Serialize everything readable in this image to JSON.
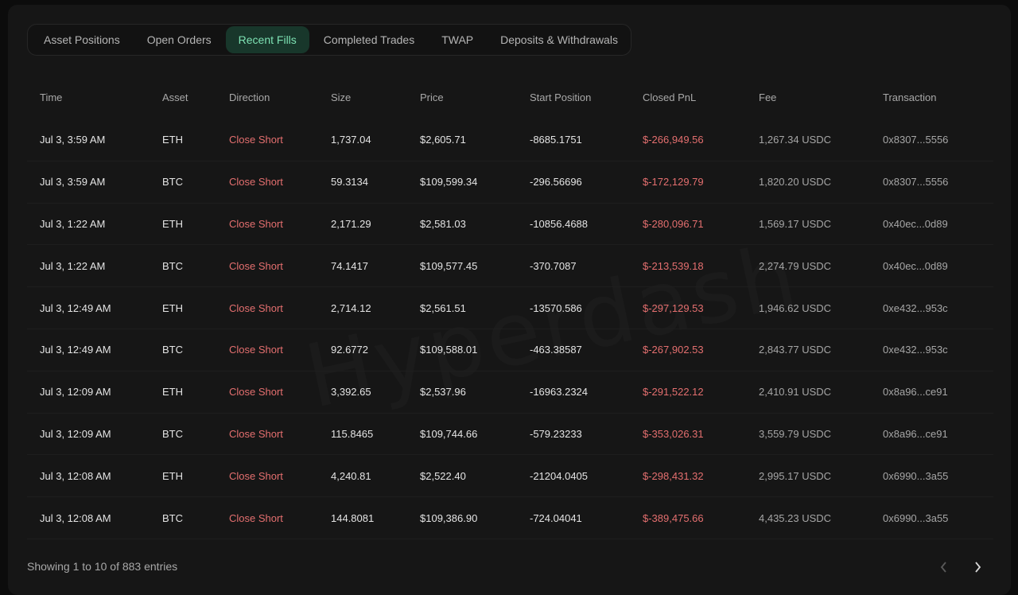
{
  "tabs": [
    {
      "label": "Asset Positions",
      "active": false
    },
    {
      "label": "Open Orders",
      "active": false
    },
    {
      "label": "Recent Fills",
      "active": true
    },
    {
      "label": "Completed Trades",
      "active": false
    },
    {
      "label": "TWAP",
      "active": false
    },
    {
      "label": "Deposits & Withdrawals",
      "active": false
    }
  ],
  "table": {
    "columns": [
      "Time",
      "Asset",
      "Direction",
      "Size",
      "Price",
      "Start Position",
      "Closed PnL",
      "Fee",
      "Transaction"
    ],
    "rows": [
      [
        "Jul 3, 3:59 AM",
        "ETH",
        "Close Short",
        "1,737.04",
        "$2,605.71",
        "-8685.1751",
        "$-266,949.56",
        "1,267.34 USDC",
        "0x8307...5556"
      ],
      [
        "Jul 3, 3:59 AM",
        "BTC",
        "Close Short",
        "59.3134",
        "$109,599.34",
        "-296.56696",
        "$-172,129.79",
        "1,820.20 USDC",
        "0x8307...5556"
      ],
      [
        "Jul 3, 1:22 AM",
        "ETH",
        "Close Short",
        "2,171.29",
        "$2,581.03",
        "-10856.4688",
        "$-280,096.71",
        "1,569.17 USDC",
        "0x40ec...0d89"
      ],
      [
        "Jul 3, 1:22 AM",
        "BTC",
        "Close Short",
        "74.1417",
        "$109,577.45",
        "-370.7087",
        "$-213,539.18",
        "2,274.79 USDC",
        "0x40ec...0d89"
      ],
      [
        "Jul 3, 12:49 AM",
        "ETH",
        "Close Short",
        "2,714.12",
        "$2,561.51",
        "-13570.586",
        "$-297,129.53",
        "1,946.62 USDC",
        "0xe432...953c"
      ],
      [
        "Jul 3, 12:49 AM",
        "BTC",
        "Close Short",
        "92.6772",
        "$109,588.01",
        "-463.38587",
        "$-267,902.53",
        "2,843.77 USDC",
        "0xe432...953c"
      ],
      [
        "Jul 3, 12:09 AM",
        "ETH",
        "Close Short",
        "3,392.65",
        "$2,537.96",
        "-16963.2324",
        "$-291,522.12",
        "2,410.91 USDC",
        "0x8a96...ce91"
      ],
      [
        "Jul 3, 12:09 AM",
        "BTC",
        "Close Short",
        "115.8465",
        "$109,744.66",
        "-579.23233",
        "$-353,026.31",
        "3,559.79 USDC",
        "0x8a96...ce91"
      ],
      [
        "Jul 3, 12:08 AM",
        "ETH",
        "Close Short",
        "4,240.81",
        "$2,522.40",
        "-21204.0405",
        "$-298,431.32",
        "2,995.17 USDC",
        "0x6990...3a55"
      ],
      [
        "Jul 3, 12:08 AM",
        "BTC",
        "Close Short",
        "144.8081",
        "$109,386.90",
        "-724.04041",
        "$-389,475.66",
        "4,435.23 USDC",
        "0x6990...3a55"
      ]
    ]
  },
  "footer": {
    "showing": "Showing 1 to 10 of 883 entries"
  },
  "colors": {
    "background": "#161616",
    "active_tab_bg": "#18372b",
    "active_tab_text": "#7ee2b4",
    "negative": "#e46f6f"
  },
  "icons": {
    "prev": "chevron-left-icon",
    "next": "chevron-right-icon"
  }
}
